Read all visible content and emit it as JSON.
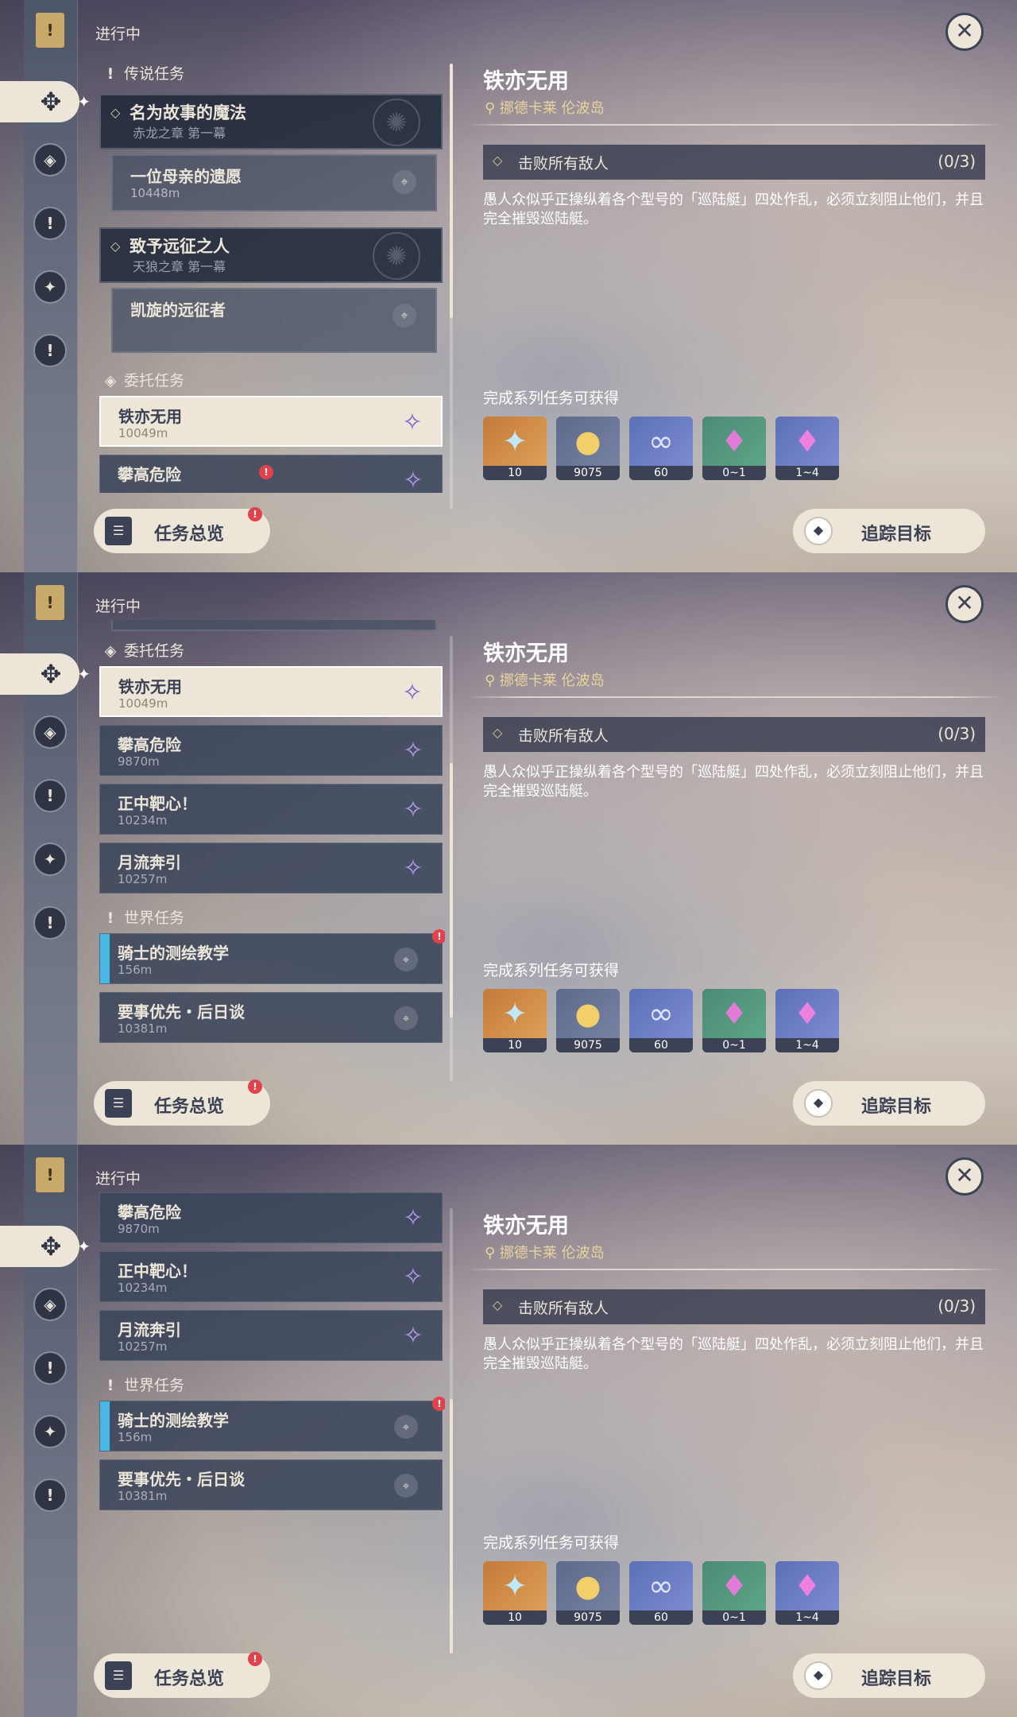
{
  "header": {
    "in_progress": "进行中"
  },
  "detail": {
    "title": "铁亦无用",
    "location": "挪德卡莱 伦波岛",
    "objective": "击败所有敌人",
    "objective_progress": "(0/3)",
    "description": "愚人众似乎正操纵着各个型号的「巡陆艇」四处作乱，必须立刻阻止他们，并且完全摧毁巡陆艇。",
    "rewards_heading": "完成系列任务可获得",
    "rewards": [
      {
        "icon": "primogem-icon",
        "qty": "10"
      },
      {
        "icon": "mora-icon",
        "qty": "9075"
      },
      {
        "icon": "adventure-exp-icon",
        "qty": "60"
      },
      {
        "icon": "crystal-chunk-icon",
        "qty": "0~1"
      },
      {
        "icon": "crystal-cluster-icon",
        "qty": "1~4"
      }
    ]
  },
  "sections": {
    "legend": "传说任务",
    "commission": "委托任务",
    "world": "世界任务"
  },
  "legend_quests": [
    {
      "title": "名为故事的魔法",
      "subtitle": "赤龙之章 第一幕",
      "step": "一位母亲的遗愿",
      "step_distance": "10448m"
    },
    {
      "title": "致予远征之人",
      "subtitle": "天狼之章 第一幕",
      "step": "凯旋的远征者"
    }
  ],
  "commissions": [
    {
      "title": "铁亦无用",
      "distance": "10049m"
    },
    {
      "title": "攀高危险",
      "distance": "9870m"
    },
    {
      "title": "正中靶心！",
      "distance": "10234m"
    },
    {
      "title": "月流奔引",
      "distance": "10257m"
    }
  ],
  "world_quests": [
    {
      "title": "骑士的测绘教学",
      "distance": "156m"
    },
    {
      "title": "要事优先・后日谈",
      "distance": "10381m"
    }
  ],
  "buttons": {
    "overview": "任务总览",
    "track": "追踪目标"
  },
  "colors": {
    "accent": "#ece5d8",
    "dark": "#3b4255",
    "location": "#e9d59c",
    "alert": "#e0444a",
    "tracked_bar": "#47b8e6"
  }
}
